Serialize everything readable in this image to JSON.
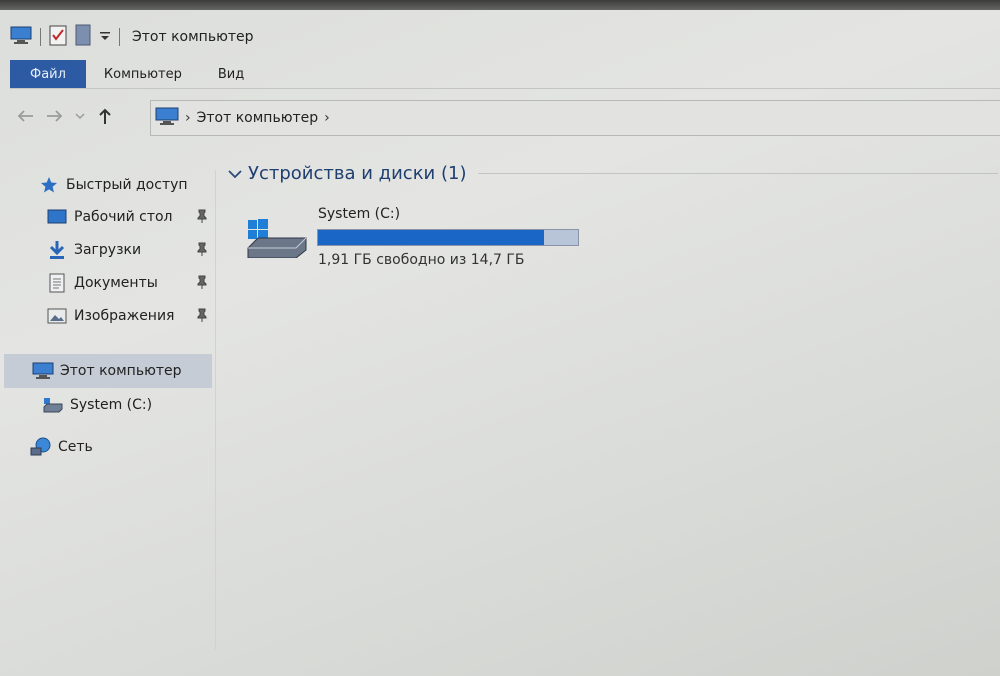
{
  "window": {
    "title": "Этот компьютер"
  },
  "ribbon": {
    "tabs": [
      "Файл",
      "Компьютер",
      "Вид"
    ]
  },
  "address": {
    "crumb": "Этот компьютер"
  },
  "sidebar": {
    "quick_access": "Быстрый доступ",
    "pinned": [
      {
        "label": "Рабочий стол",
        "icon": "desktop-folder-icon"
      },
      {
        "label": "Загрузки",
        "icon": "downloads-icon"
      },
      {
        "label": "Документы",
        "icon": "documents-icon"
      },
      {
        "label": "Изображения",
        "icon": "pictures-icon"
      }
    ],
    "this_pc": "Этот компьютер",
    "drive": "System (C:)",
    "network": "Сеть"
  },
  "content": {
    "group_title": "Устройства и диски (1)",
    "drives": [
      {
        "name": "System (C:)",
        "free_text": "1,91 ГБ свободно из 14,7 ГБ",
        "used_fraction": 0.87
      }
    ]
  },
  "colors": {
    "file_tab": "#2c5aa3",
    "drive_bar_fill": "#1a66c7",
    "drive_bar_bg": "#b8c4d8",
    "group_title": "#1f3f70"
  }
}
